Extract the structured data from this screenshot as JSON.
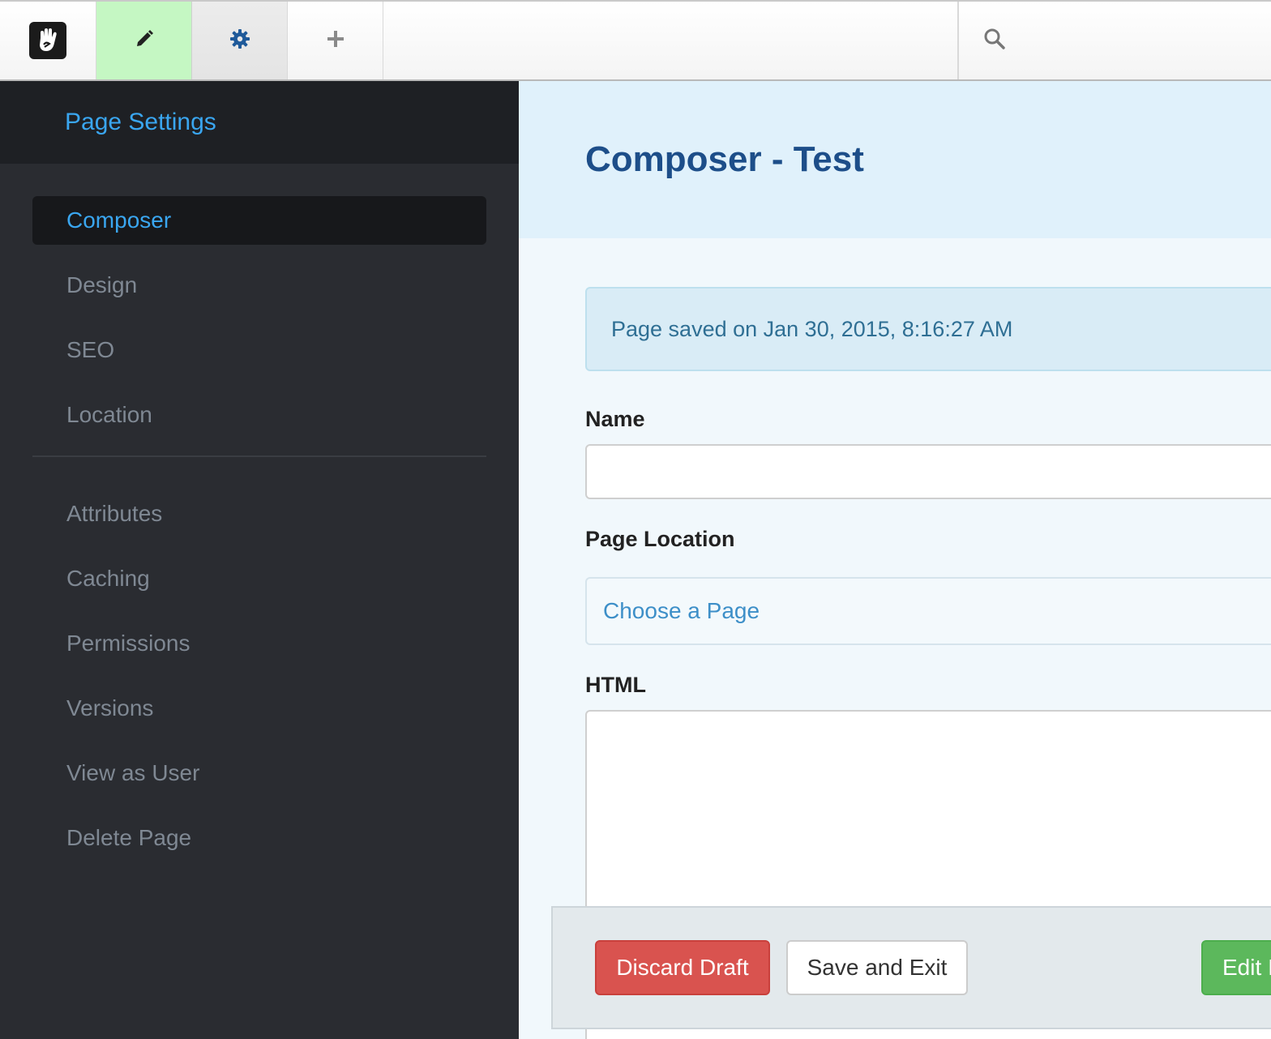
{
  "toolbar": {
    "logo_icon": "concrete5-hand-logo-icon",
    "edit_icon": "pencil-icon",
    "settings_icon": "gear-icon",
    "add_icon": "plus-icon",
    "search_icon": "search-icon",
    "edit_active_color": "#c5f7c3"
  },
  "sidebar": {
    "title": "Page Settings",
    "primary_items": [
      {
        "label": "Composer",
        "active": true
      },
      {
        "label": "Design"
      },
      {
        "label": "SEO"
      },
      {
        "label": "Location"
      }
    ],
    "secondary_items": [
      {
        "label": "Attributes"
      },
      {
        "label": "Caching"
      },
      {
        "label": "Permissions"
      },
      {
        "label": "Versions"
      },
      {
        "label": "View as User"
      },
      {
        "label": "Delete Page"
      }
    ]
  },
  "main": {
    "title": "Composer - Test",
    "alert": "Page saved on Jan 30, 2015, 8:16:27 AM",
    "name_label": "Name",
    "name_value": "",
    "location_label": "Page Location",
    "location_chooser": "Choose a Page",
    "html_label": "HTML",
    "html_value": ""
  },
  "actions": {
    "discard": "Discard Draft",
    "save_exit": "Save and Exit",
    "edit": "Edit I"
  },
  "colors": {
    "accent": "#3aa6f0",
    "danger": "#d9534f",
    "success": "#5cb85c",
    "title": "#1d4e89"
  }
}
